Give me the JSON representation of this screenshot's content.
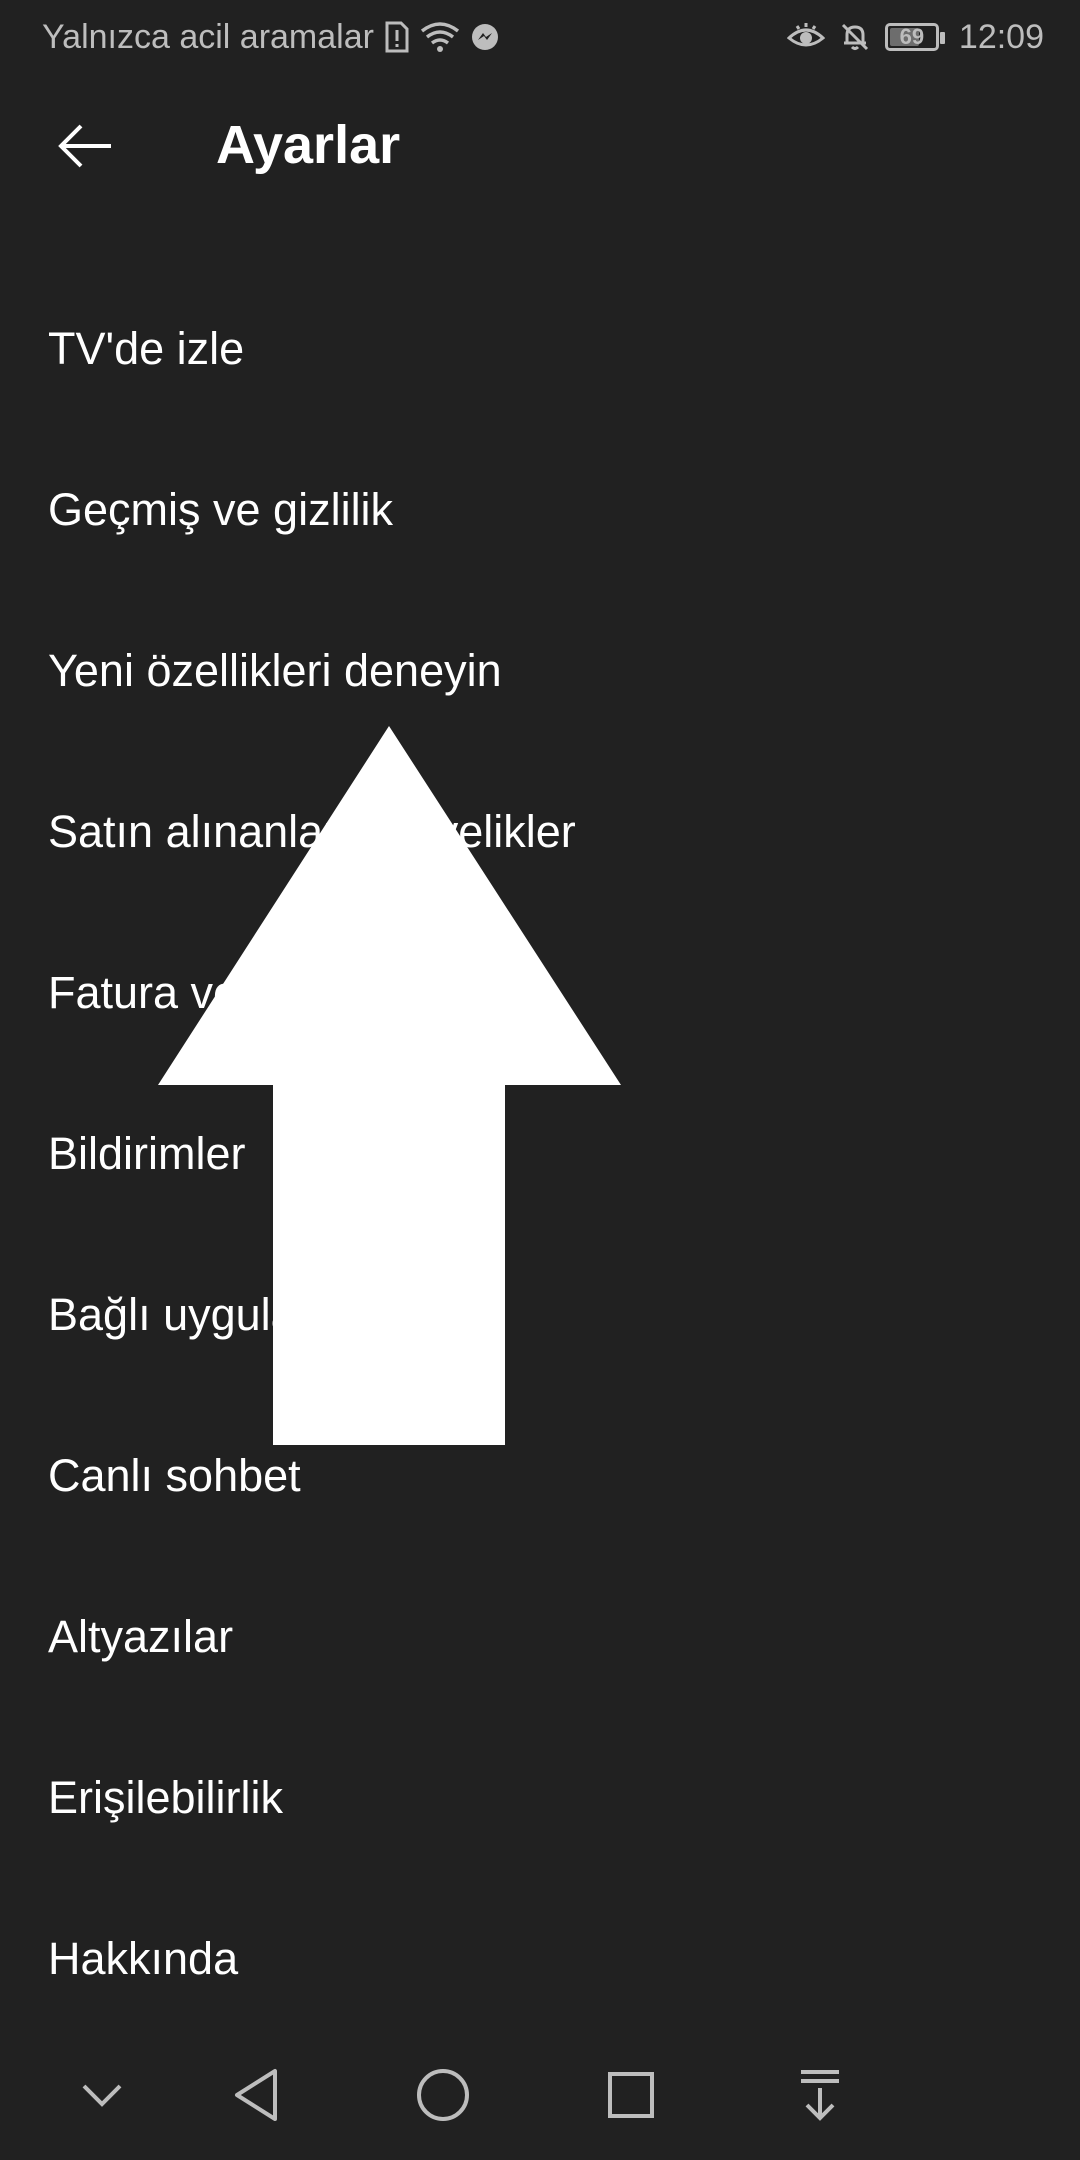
{
  "status_bar": {
    "carrier_text": "Yalnızca acil aramalar",
    "battery_level": "69",
    "battery_fraction": 0.69,
    "time": "12:09",
    "icons": [
      "sim-alert-icon",
      "wifi-icon",
      "messenger-icon",
      "eye-icon",
      "bell-off-icon",
      "battery-icon"
    ]
  },
  "header": {
    "title": "Ayarlar",
    "back_icon": "arrow-left-icon"
  },
  "settings": {
    "items": [
      {
        "label": "TV'de izle"
      },
      {
        "label": "Geçmiş ve gizlilik"
      },
      {
        "label": "Yeni özellikleri deneyin"
      },
      {
        "label": "Satın alınanlar ve üyelikler"
      },
      {
        "label": "Fatura ve ödemeler"
      },
      {
        "label": "Bildirimler"
      },
      {
        "label": "Bağlı uygulamalar"
      },
      {
        "label": "Canlı sohbet"
      },
      {
        "label": "Altyazılar"
      },
      {
        "label": "Erişilebilirlik"
      },
      {
        "label": "Hakkında"
      }
    ]
  },
  "overlay": {
    "icon": "up-arrow-icon",
    "color": "#ffffff"
  },
  "nav_bar": {
    "buttons": [
      "chevron-down-icon",
      "back-triangle-icon",
      "home-circle-icon",
      "recents-square-icon",
      "notification-pulldown-icon"
    ]
  },
  "colors": {
    "background": "#212121",
    "text": "#ffffff",
    "status_text": "#bdbdbd"
  }
}
